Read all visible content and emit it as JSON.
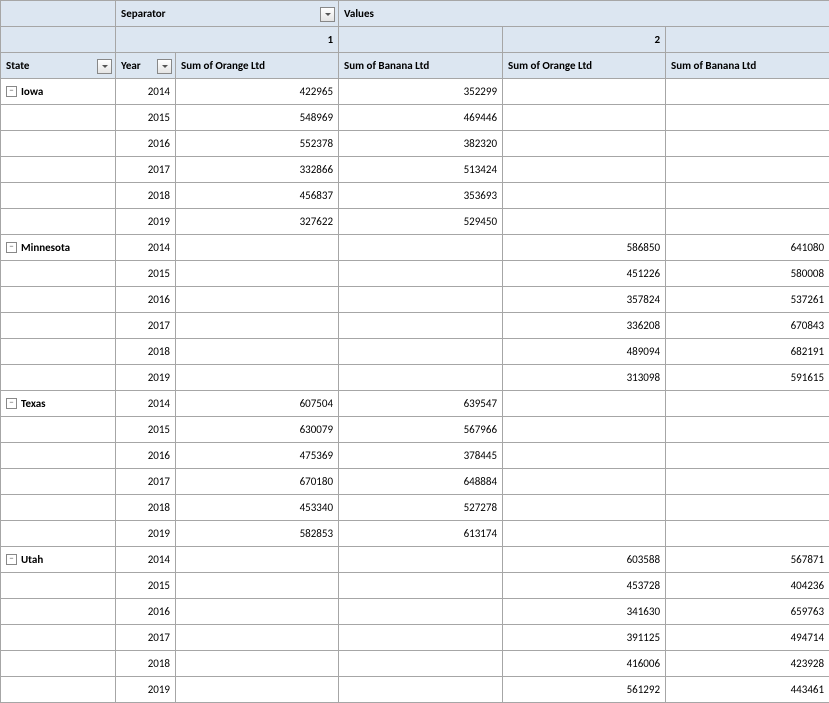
{
  "top": {
    "separator_label": "Separator",
    "values_label": "Values",
    "group1": "1",
    "group2": "2"
  },
  "cols": {
    "state": "State",
    "year": "Year",
    "o": "Sum of Orange Ltd",
    "b": "Sum of Banana Ltd"
  },
  "states": [
    {
      "name": "Iowa",
      "grp": 1,
      "rows": [
        {
          "y": "2014",
          "o": "422965",
          "b": "352299"
        },
        {
          "y": "2015",
          "o": "548969",
          "b": "469446"
        },
        {
          "y": "2016",
          "o": "552378",
          "b": "382320"
        },
        {
          "y": "2017",
          "o": "332866",
          "b": "513424"
        },
        {
          "y": "2018",
          "o": "456837",
          "b": "353693"
        },
        {
          "y": "2019",
          "o": "327622",
          "b": "529450"
        }
      ]
    },
    {
      "name": "Minnesota",
      "grp": 2,
      "rows": [
        {
          "y": "2014",
          "o": "586850",
          "b": "641080"
        },
        {
          "y": "2015",
          "o": "451226",
          "b": "580008"
        },
        {
          "y": "2016",
          "o": "357824",
          "b": "537261"
        },
        {
          "y": "2017",
          "o": "336208",
          "b": "670843"
        },
        {
          "y": "2018",
          "o": "489094",
          "b": "682191"
        },
        {
          "y": "2019",
          "o": "313098",
          "b": "591615"
        }
      ]
    },
    {
      "name": "Texas",
      "grp": 1,
      "rows": [
        {
          "y": "2014",
          "o": "607504",
          "b": "639547"
        },
        {
          "y": "2015",
          "o": "630079",
          "b": "567966"
        },
        {
          "y": "2016",
          "o": "475369",
          "b": "378445"
        },
        {
          "y": "2017",
          "o": "670180",
          "b": "648884"
        },
        {
          "y": "2018",
          "o": "453340",
          "b": "527278"
        },
        {
          "y": "2019",
          "o": "582853",
          "b": "613174"
        }
      ]
    },
    {
      "name": "Utah",
      "grp": 2,
      "rows": [
        {
          "y": "2014",
          "o": "603588",
          "b": "567871"
        },
        {
          "y": "2015",
          "o": "453728",
          "b": "404236"
        },
        {
          "y": "2016",
          "o": "341630",
          "b": "659763"
        },
        {
          "y": "2017",
          "o": "391125",
          "b": "494714"
        },
        {
          "y": "2018",
          "o": "416006",
          "b": "423928"
        },
        {
          "y": "2019",
          "o": "561292",
          "b": "443461"
        }
      ]
    }
  ]
}
